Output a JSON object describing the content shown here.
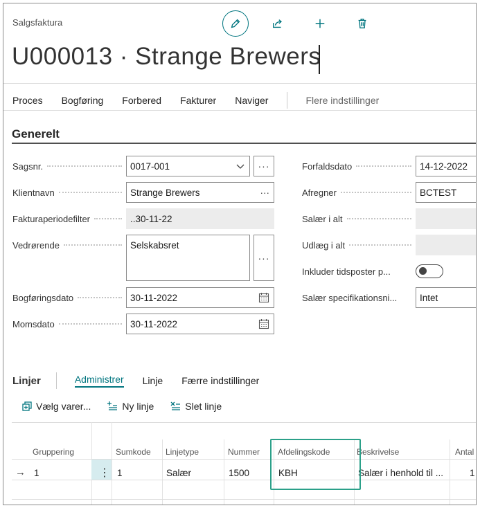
{
  "header": {
    "breadcrumb": "Salgsfaktura",
    "title": "U000013 · Strange Brewers"
  },
  "actions": {
    "items": [
      "Proces",
      "Bogføring",
      "Forbered",
      "Fakturer",
      "Naviger"
    ],
    "more": "Flere indstillinger"
  },
  "section": {
    "title": "Generelt"
  },
  "fields": {
    "sagsnr_label": "Sagsnr.",
    "sagsnr_value": "0017-001",
    "klientnavn_label": "Klientnavn",
    "klientnavn_value": "Strange Brewers",
    "fakturaperiode_label": "Fakturaperiodefilter",
    "fakturaperiode_value": "..30-11-22",
    "vedroerende_label": "Vedrørende",
    "vedroerende_value": "Selskabsret",
    "bogfoeringsdato_label": "Bogføringsdato",
    "bogfoeringsdato_value": "30-11-2022",
    "momsdato_label": "Momsdato",
    "momsdato_value": "30-11-2022",
    "forfaldsdato_label": "Forfaldsdato",
    "forfaldsdato_value": "14-12-2022",
    "afregner_label": "Afregner",
    "afregner_value": "BCTEST",
    "salaer_label": "Salær i alt",
    "salaer_value": "",
    "udlaeg_label": "Udlæg i alt",
    "udlaeg_value": "",
    "inkluder_label": "Inkluder tidsposter p...",
    "inkluder_on": false,
    "salaer_spec_label": "Salær specifikationsni...",
    "salaer_spec_value": "Intet",
    "ellipsis": "···"
  },
  "lines": {
    "title": "Linjer",
    "tabs": [
      "Administrer",
      "Linje",
      "Færre indstillinger"
    ],
    "actions": [
      "Vælg varer...",
      "Ny linje",
      "Slet linje"
    ],
    "columns": [
      "Gruppering",
      "Sumkode",
      "Linjetype",
      "Nummer",
      "Afdelingskode",
      "Beskrivelse",
      "Antal"
    ],
    "rows": [
      {
        "arrow": "→",
        "gruppering": "1",
        "menu": "⋮",
        "sumkode": "1",
        "linjetype": "Salær",
        "nummer": "1500",
        "afdelingskode": "KBH",
        "beskrivelse": "Salær i henhold til ...",
        "antal": "1"
      }
    ]
  },
  "colors": {
    "accent": "#00757f",
    "highlight": "#2ba089"
  }
}
